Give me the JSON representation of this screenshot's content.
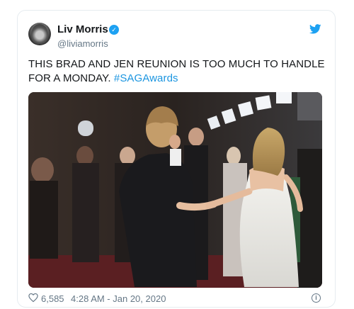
{
  "tweet": {
    "display_name": "Liv Morris",
    "handle": "@liviamorris",
    "text_main": "THIS BRAD AND JEN REUNION IS TOO MUCH TO HANDLE FOR A MONDAY. ",
    "hashtag": "#SAGAwards",
    "likes": "6,585",
    "timestamp": "4:28 AM - Jan 20, 2020"
  },
  "icons": {
    "verified": "verified-badge-icon",
    "platform": "twitter-bird-icon",
    "like": "heart-icon",
    "info": "info-icon"
  },
  "colors": {
    "accent": "#1da1f2",
    "link": "#1b95e0",
    "text": "#14171a",
    "muted": "#657786"
  }
}
